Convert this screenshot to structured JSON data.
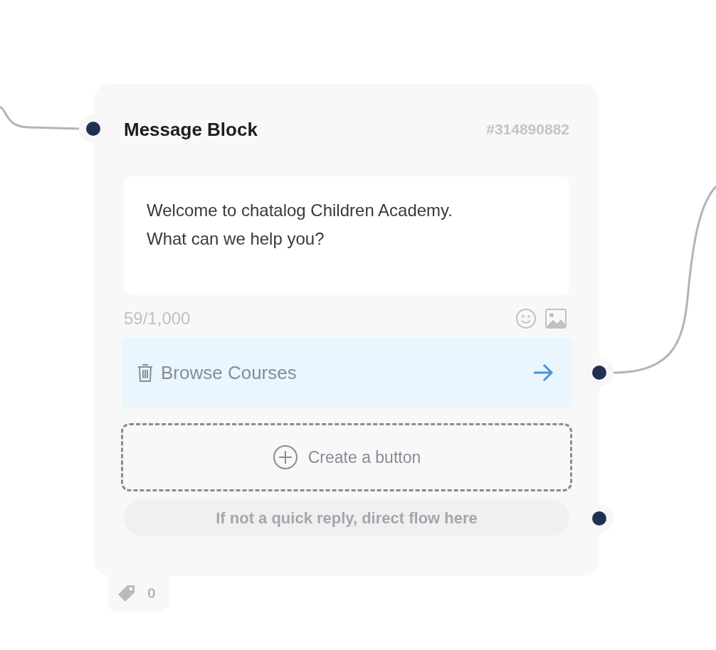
{
  "block": {
    "title": "Message Block",
    "id": "#314890882",
    "message": "Welcome to chatalog Children Academy.\nWhat can we help you?",
    "char_count": "59/1,000",
    "quick_replies": [
      {
        "label": "Browse Courses"
      }
    ],
    "create_button": "Create a button",
    "fallback": "If not a quick reply, direct flow here",
    "tag_count": "0"
  }
}
